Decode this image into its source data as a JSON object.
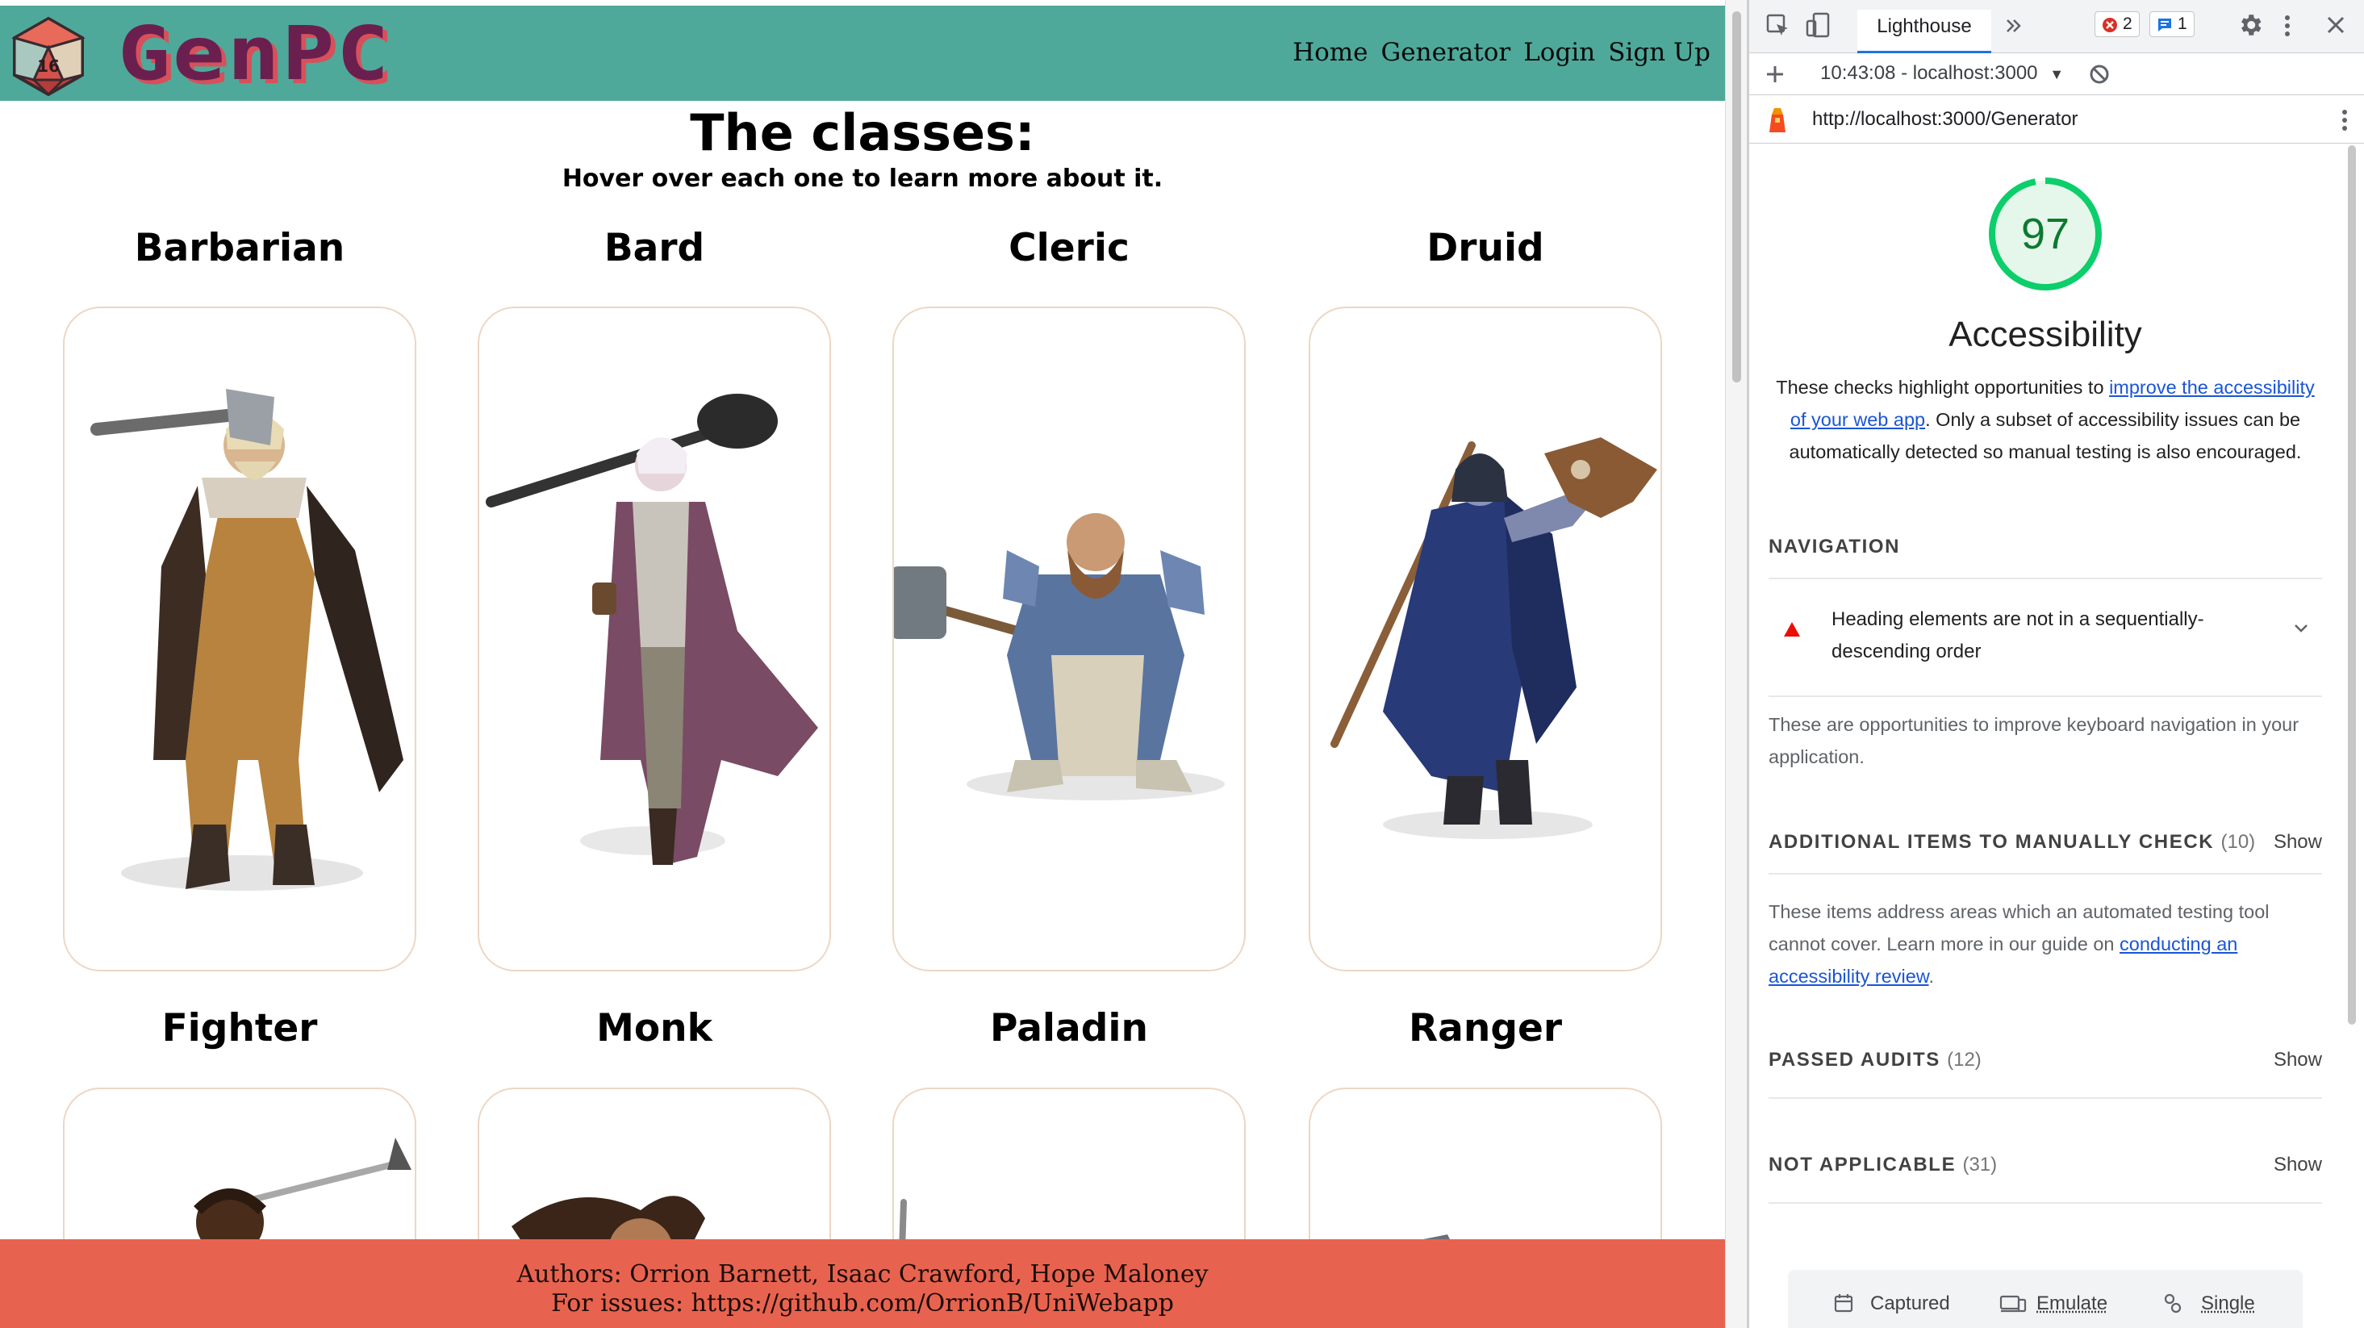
{
  "site": {
    "logo_text": "GenPC",
    "nav": [
      "Home",
      "Generator",
      "Login",
      "Sign Up"
    ],
    "title": "The classes:",
    "subtitle": "Hover over each one to learn more about it.",
    "classes": [
      "Barbarian",
      "Bard",
      "Cleric",
      "Druid",
      "Fighter",
      "Monk",
      "Paladin",
      "Ranger"
    ],
    "footer_authors": "Authors: Orrion Barnett, Isaac Crawford, Hope Maloney",
    "footer_issues": "For issues: https://github.com/OrrionB/UniWebapp",
    "colors": {
      "navbar": "#4ea99a",
      "footer": "#e8634f",
      "logo": "#6a1f4f"
    }
  },
  "devtools": {
    "tab_label": "Lighthouse",
    "error_count": "2",
    "message_count": "1",
    "report_select": "10:43:08 - localhost:3000",
    "url": "http://localhost:3000/Generator",
    "score": 97,
    "score_color": "#0c7a31",
    "category_title": "Accessibility",
    "desc_pre": "These checks highlight opportunities to ",
    "desc_link": "improve the accessibility of your web app",
    "desc_post": ". Only a subset of accessibility issues can be automatically detected so manual testing is also encouraged.",
    "navigation": {
      "header": "NAVIGATION",
      "audit": "Heading elements are not in a sequentially-descending order",
      "description": "These are opportunities to improve keyboard navigation in your application."
    },
    "manual": {
      "header": "ADDITIONAL ITEMS TO MANUALLY CHECK",
      "count": "(10)",
      "show": "Show",
      "desc_pre": "These items address areas which an automated testing tool cannot cover. Learn more in our guide on ",
      "desc_link": "conducting an accessibility review",
      "desc_post": "."
    },
    "passed": {
      "header": "PASSED AUDITS",
      "count": "(12)",
      "show": "Show"
    },
    "not_applicable": {
      "header": "NOT APPLICABLE",
      "count": "(31)",
      "show": "Show"
    },
    "env": {
      "captured": "Captured",
      "emulate": "Emulate",
      "single": "Single"
    }
  }
}
